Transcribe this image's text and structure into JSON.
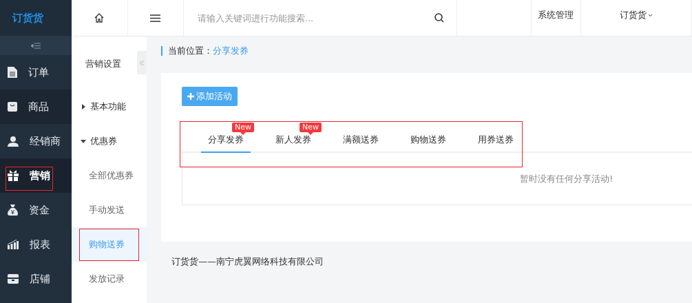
{
  "logo": "订货货",
  "sidebar": {
    "items": [
      {
        "label": "订单",
        "selected": false,
        "hovered": false,
        "highlight": false
      },
      {
        "label": "商品",
        "selected": false,
        "hovered": true,
        "highlight": false
      },
      {
        "label": "经销商",
        "selected": false,
        "hovered": false,
        "highlight": false
      },
      {
        "label": "营销",
        "selected": true,
        "hovered": false,
        "highlight": true
      },
      {
        "label": "资金",
        "selected": false,
        "hovered": false,
        "highlight": false
      },
      {
        "label": "报表",
        "selected": false,
        "hovered": false,
        "highlight": false
      },
      {
        "label": "店铺",
        "selected": false,
        "hovered": false,
        "highlight": false
      }
    ]
  },
  "submenu": {
    "title": "营销设置",
    "groups": [
      {
        "label": "基本功能",
        "expanded": false
      },
      {
        "label": "优惠券",
        "expanded": true,
        "children": [
          {
            "label": "全部优惠券",
            "selected": false,
            "highlight": false
          },
          {
            "label": "手动发送",
            "selected": false,
            "highlight": false
          },
          {
            "label": "购物送券",
            "selected": true,
            "highlight": true
          },
          {
            "label": "发放记录",
            "selected": false,
            "highlight": false
          }
        ]
      }
    ]
  },
  "topbar": {
    "search": {
      "placeholder": "请输入关键词进行功能搜索..."
    },
    "menus": [
      "系统管理",
      "订货货"
    ]
  },
  "breadcrumb": {
    "label": "当前位置：",
    "current": "分享发券"
  },
  "add_button": "添加活动",
  "tabs": {
    "highlight": true,
    "items": [
      {
        "label": "分享发券",
        "badge": "New",
        "selected": true
      },
      {
        "label": "新人发券",
        "badge": "New",
        "selected": false
      },
      {
        "label": "满额送券",
        "selected": false
      },
      {
        "label": "购物送券",
        "selected": false
      },
      {
        "label": "用券送券",
        "selected": false
      }
    ]
  },
  "empty_message": "暂时没有任何分享活动!",
  "footer": "订货货——南宁虎翼网络科技有限公司"
}
